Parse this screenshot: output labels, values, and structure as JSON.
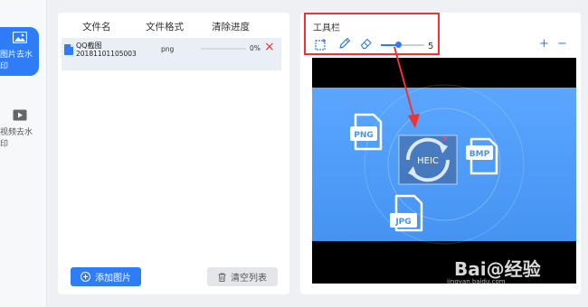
{
  "sidebar": {
    "items": [
      {
        "label": "图片去水印",
        "icon": "image-icon",
        "active": true
      },
      {
        "label": "视频去水印",
        "icon": "video-icon",
        "active": false
      }
    ]
  },
  "file_list": {
    "headers": {
      "name": "文件名",
      "format": "文件格式",
      "progress": "清除进度"
    },
    "rows": [
      {
        "name": "QQ截图",
        "name_sub": "20181101105003",
        "format": "png",
        "progress": 0,
        "progress_text": "0%"
      }
    ],
    "add_button": "添加图片",
    "clear_button": "清空列表"
  },
  "toolbox": {
    "title": "工具栏",
    "tools": [
      "crop-icon",
      "pen-icon",
      "eraser-icon"
    ],
    "brush_size": "5",
    "brush_level": 0.35,
    "zoom_in": "+",
    "zoom_out": "−"
  },
  "preview": {
    "center_label": "HEIC",
    "labels": [
      "PNG",
      "BMP",
      "JPG"
    ],
    "close_mark": "×"
  },
  "watermark": {
    "logo": "Bai@经验",
    "url": "jingyan.baidu.com"
  },
  "colors": {
    "accent": "#2e7cf6",
    "highlight": "#e33333",
    "delete": "#e03a3a"
  }
}
